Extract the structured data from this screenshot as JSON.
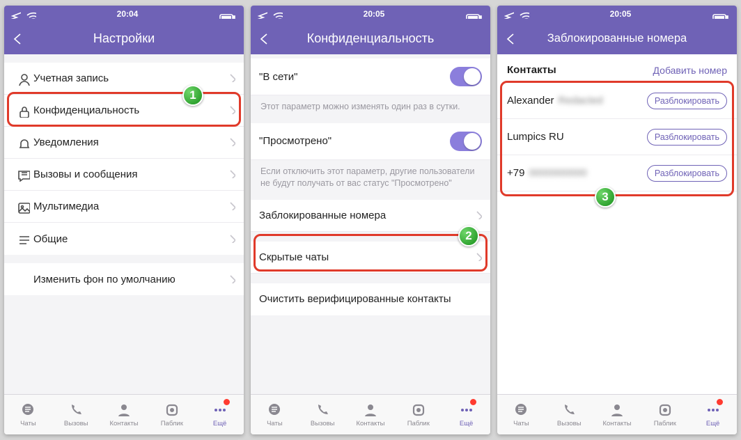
{
  "colors": {
    "accent": "#6f62b6",
    "highlight": "#e03a2a"
  },
  "tabbar": [
    {
      "name": "chats",
      "label": "Чаты"
    },
    {
      "name": "calls",
      "label": "Вызовы"
    },
    {
      "name": "contacts",
      "label": "Контакты"
    },
    {
      "name": "public",
      "label": "Паблик"
    },
    {
      "name": "more",
      "label": "Ещё"
    }
  ],
  "screens": [
    {
      "status_time": "20:04",
      "title": "Настройки",
      "badge": "1",
      "settings": [
        {
          "name": "account",
          "label": "Учетная запись"
        },
        {
          "name": "privacy",
          "label": "Конфиденциальность"
        },
        {
          "name": "notifications",
          "label": "Уведомления"
        },
        {
          "name": "calls-msgs",
          "label": "Вызовы и сообщения"
        },
        {
          "name": "media",
          "label": "Мультимедиа"
        },
        {
          "name": "general",
          "label": "Общие"
        }
      ],
      "change_bg": "Изменить фон по умолчанию"
    },
    {
      "status_time": "20:05",
      "title": "Конфиденциальность",
      "badge": "2",
      "online_label": "\"В сети\"",
      "online_desc": "Этот параметр можно изменять один раз в сутки.",
      "seen_label": "\"Просмотрено\"",
      "seen_desc": "Если отключить этот параметр, другие пользователи не будут получать от вас статус \"Просмотрено\"",
      "blocked_label": "Заблокированные номера",
      "hidden_label": "Скрытые чаты",
      "clear_label": "Очистить верифицированные контакты"
    },
    {
      "status_time": "20:05",
      "title": "Заблокированные номера",
      "badge": "3",
      "contacts_heading": "Контакты",
      "add_number": "Добавить номер",
      "unblock_label": "Разблокировать",
      "contacts": [
        {
          "name": "Alexander",
          "hidden_tail": "redacted"
        },
        {
          "name": "Lumpics RU"
        },
        {
          "name": "+79",
          "hidden_tail": "redacted"
        }
      ]
    }
  ]
}
